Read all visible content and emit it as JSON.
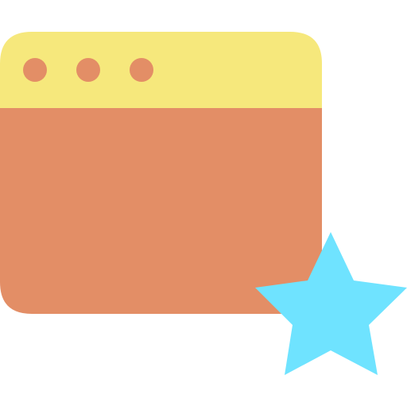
{
  "icon": {
    "name": "favorite-window-icon",
    "parts": {
      "window": "browser-window",
      "title_bar": "window-title-bar",
      "dots": [
        "window-dot-1",
        "window-dot-2",
        "window-dot-3"
      ],
      "star": "star-icon"
    }
  },
  "colors": {
    "title_bar": "#F6E87C",
    "window_body": "#E38E66",
    "dots": "#E38E66",
    "star": "#6FE3FF",
    "background": "#FFFFFF"
  }
}
